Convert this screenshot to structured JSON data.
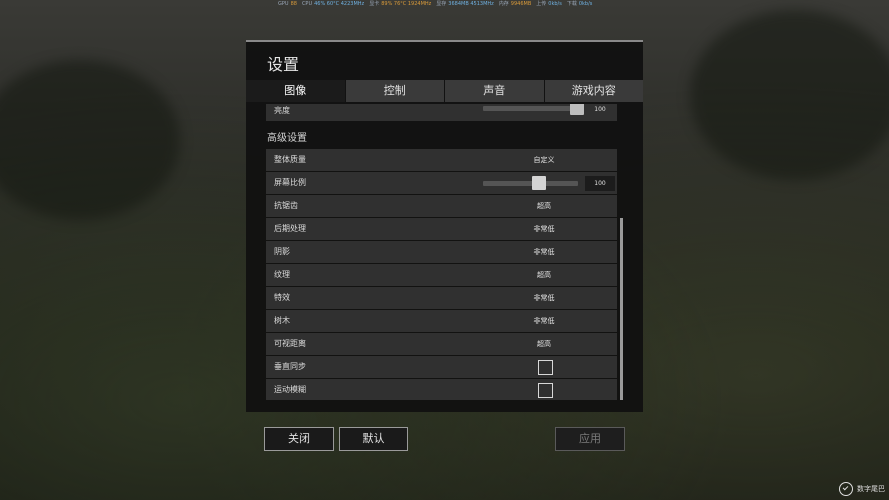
{
  "overlay": [
    {
      "label": "GPU",
      "value": "88"
    },
    {
      "label": "CPU",
      "value": "46% 60°C 4223MHz"
    },
    {
      "label": "显卡",
      "value": "89% 76°C 1924MHz"
    },
    {
      "label": "显存",
      "value": "3684MB 4513MHz"
    },
    {
      "label": "内存",
      "value": "9946MB"
    },
    {
      "label": "上传",
      "value": "0kb/s"
    },
    {
      "label": "下载",
      "value": "0kb/s"
    }
  ],
  "dialog": {
    "title": "设置",
    "tabs": [
      "图像",
      "控制",
      "声音",
      "游戏内容"
    ],
    "active_tab": "图像"
  },
  "settings": {
    "brightness": {
      "label": "亮度",
      "value": "100"
    },
    "section_title": "高级设置",
    "overall_quality": {
      "label": "整体质量",
      "value": "自定义"
    },
    "screen_scale": {
      "label": "屏幕比例",
      "value": "100"
    },
    "anti_aliasing": {
      "label": "抗锯齿",
      "value": "超高"
    },
    "post_processing": {
      "label": "后期处理",
      "value": "非常低"
    },
    "shadows": {
      "label": "阴影",
      "value": "非常低"
    },
    "textures": {
      "label": "纹理",
      "value": "超高"
    },
    "effects": {
      "label": "特效",
      "value": "非常低"
    },
    "foliage": {
      "label": "树木",
      "value": "非常低"
    },
    "view_distance": {
      "label": "可视距离",
      "value": "超高"
    },
    "vsync": {
      "label": "垂直同步",
      "checked": false
    },
    "motion_blur": {
      "label": "运动模糊",
      "checked": false
    }
  },
  "footer": {
    "close_label": "关闭",
    "default_label": "默认",
    "apply_label": "应用"
  },
  "watermark": {
    "text": "数字尾巴"
  },
  "colors": {
    "row_bg": "#303030",
    "tab_bg": "#3a3a3a",
    "tab_active_bg": "#1b1b1b"
  }
}
